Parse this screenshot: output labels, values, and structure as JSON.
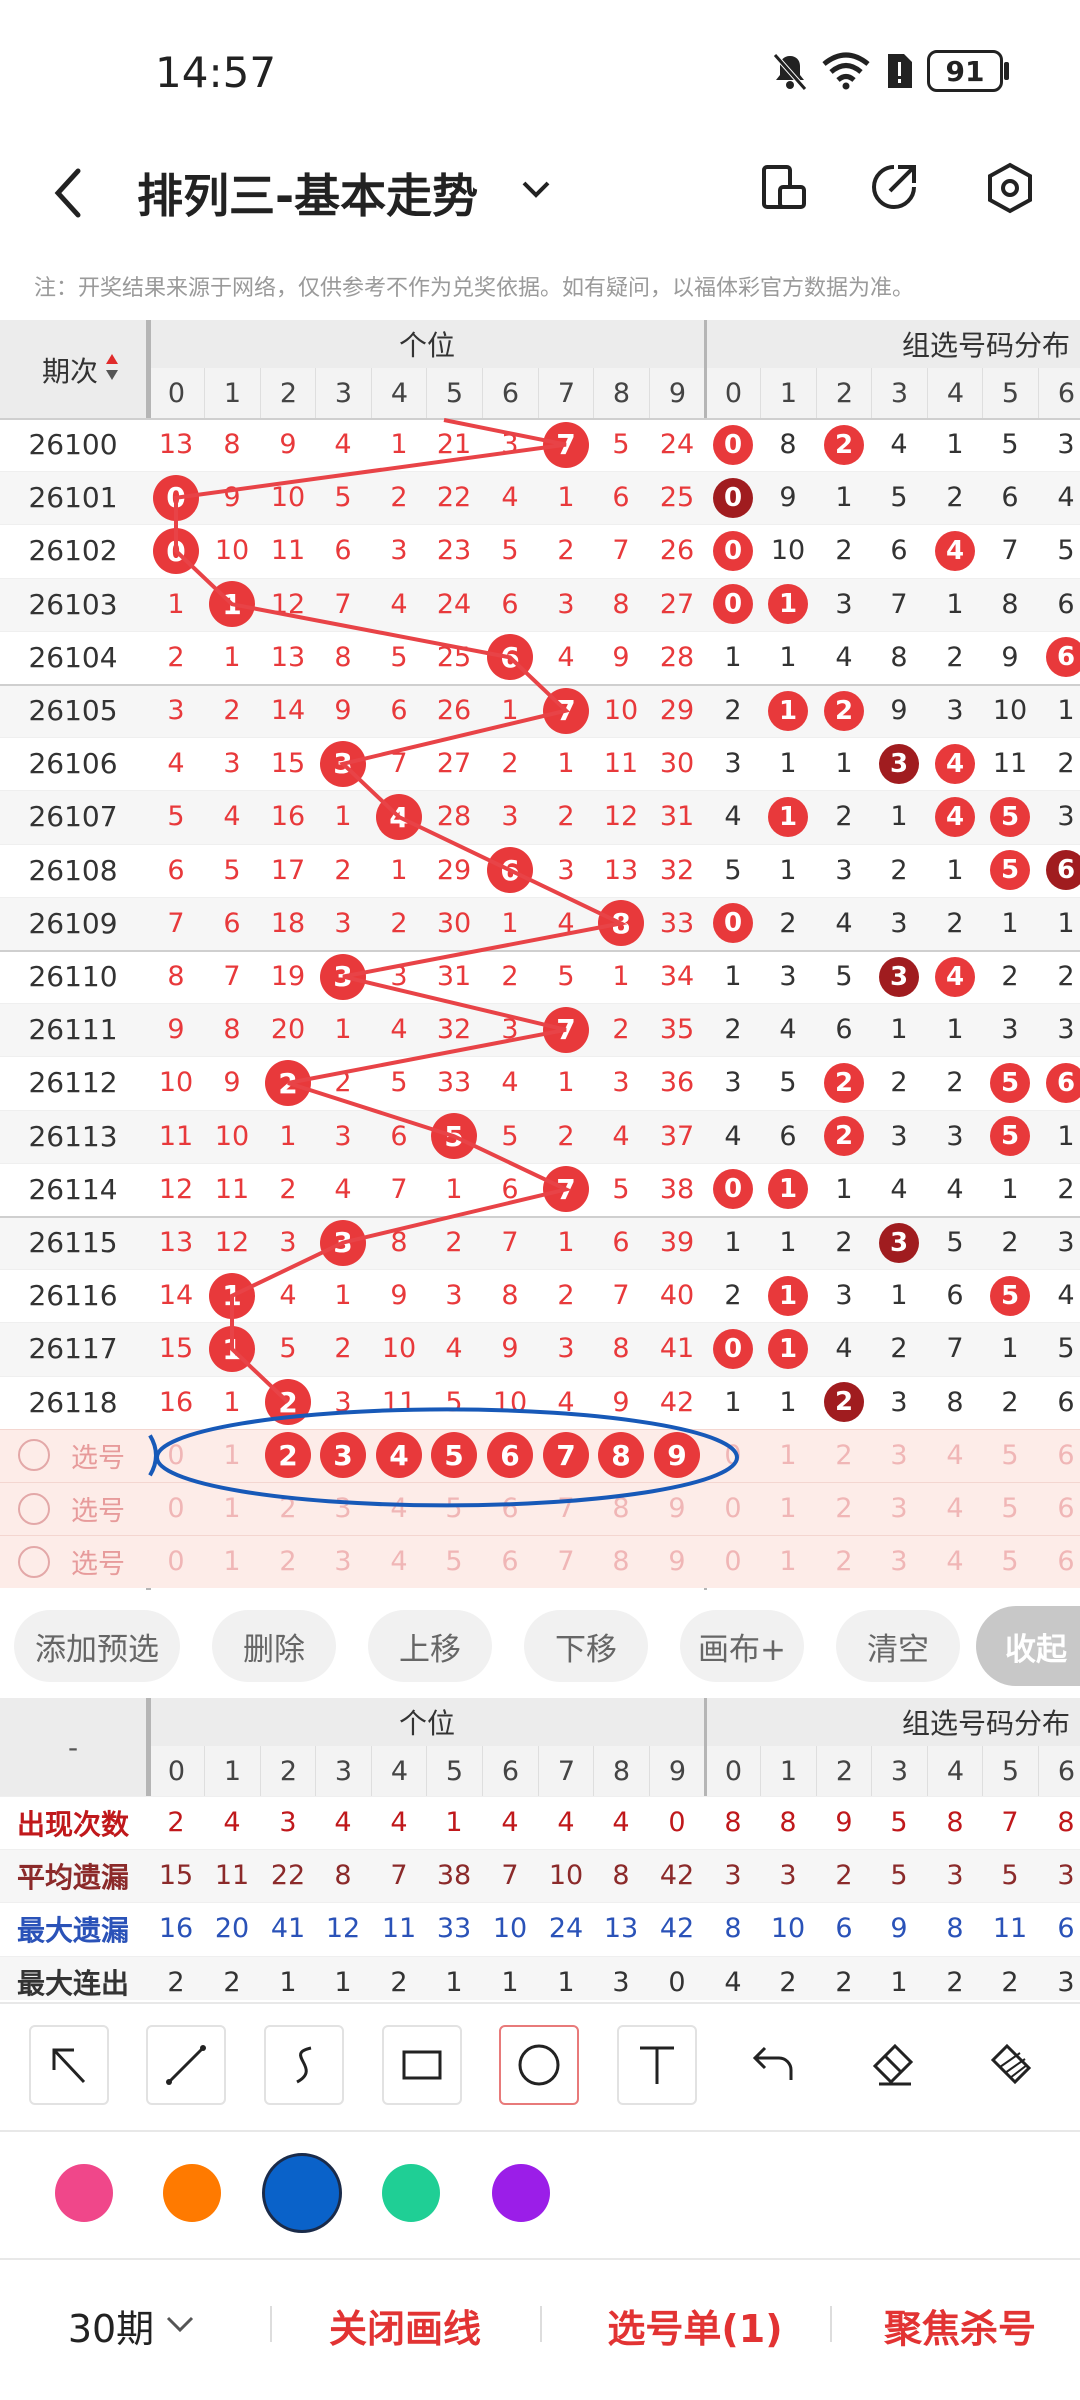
{
  "status_bar": {
    "time": "14:57",
    "battery": "91",
    "icons": [
      "mute-icon",
      "wifi-icon",
      "sim-alert-icon",
      "battery-icon"
    ]
  },
  "header": {
    "title": "排列三-基本走势",
    "icons": [
      "back-icon",
      "dropdown-chevron-icon",
      "layout-icon",
      "share-icon",
      "settings-icon"
    ]
  },
  "note": "注：开奖结果来源于网络，仅供参考不作为兑奖依据。如有疑问，以福体彩官方数据为准。",
  "main_table": {
    "period_header": "期次",
    "section_left": "个位",
    "section_right": "组选号码分布",
    "columns_left": [
      "0",
      "1",
      "2",
      "3",
      "4",
      "5",
      "6",
      "7",
      "8",
      "9"
    ],
    "columns_right": [
      "0",
      "1",
      "2",
      "3",
      "4",
      "5",
      "6"
    ],
    "rows": [
      {
        "period": "26100",
        "left": [
          "13",
          "8",
          "9",
          "4",
          "1",
          "21",
          "3",
          "7",
          "5",
          "24"
        ],
        "hit": 7,
        "right": [
          "0",
          "8",
          "2",
          "4",
          "1",
          "5",
          "3"
        ],
        "right_hits": [
          0,
          2
        ],
        "dark": []
      },
      {
        "period": "26101",
        "left": [
          "0",
          "9",
          "10",
          "5",
          "2",
          "22",
          "4",
          "1",
          "6",
          "25"
        ],
        "hit": 0,
        "right": [
          "0",
          "9",
          "1",
          "5",
          "2",
          "6",
          "4"
        ],
        "right_hits": [
          0
        ],
        "dark": [
          0
        ]
      },
      {
        "period": "26102",
        "left": [
          "0",
          "10",
          "11",
          "6",
          "3",
          "23",
          "5",
          "2",
          "7",
          "26"
        ],
        "hit": 0,
        "right": [
          "0",
          "10",
          "2",
          "6",
          "4",
          "7",
          "5"
        ],
        "right_hits": [
          0,
          4
        ],
        "dark": []
      },
      {
        "period": "26103",
        "left": [
          "1",
          "1",
          "12",
          "7",
          "4",
          "24",
          "6",
          "3",
          "8",
          "27"
        ],
        "hit": 1,
        "right": [
          "0",
          "1",
          "3",
          "7",
          "1",
          "8",
          "6"
        ],
        "right_hits": [
          0,
          1
        ],
        "dark": []
      },
      {
        "period": "26104",
        "left": [
          "2",
          "1",
          "13",
          "8",
          "5",
          "25",
          "6",
          "4",
          "9",
          "28"
        ],
        "hit": 6,
        "right": [
          "1",
          "1",
          "4",
          "8",
          "2",
          "9",
          "6"
        ],
        "right_hits": [
          6
        ],
        "dark": []
      },
      {
        "period": "26105",
        "left": [
          "3",
          "2",
          "14",
          "9",
          "6",
          "26",
          "1",
          "7",
          "10",
          "29"
        ],
        "hit": 7,
        "right": [
          "2",
          "1",
          "2",
          "9",
          "3",
          "10",
          "1"
        ],
        "right_hits": [
          1,
          2
        ],
        "dark": []
      },
      {
        "period": "26106",
        "left": [
          "4",
          "3",
          "15",
          "3",
          "7",
          "27",
          "2",
          "1",
          "11",
          "30"
        ],
        "hit": 3,
        "right": [
          "3",
          "1",
          "1",
          "3",
          "4",
          "11",
          "2"
        ],
        "right_hits": [
          3,
          4
        ],
        "dark": [
          3
        ]
      },
      {
        "period": "26107",
        "left": [
          "5",
          "4",
          "16",
          "1",
          "4",
          "28",
          "3",
          "2",
          "12",
          "31"
        ],
        "hit": 4,
        "right": [
          "4",
          "1",
          "2",
          "1",
          "4",
          "5",
          "3"
        ],
        "right_hits": [
          1,
          4,
          5
        ],
        "dark": []
      },
      {
        "period": "26108",
        "left": [
          "6",
          "5",
          "17",
          "2",
          "1",
          "29",
          "6",
          "3",
          "13",
          "32"
        ],
        "hit": 6,
        "right": [
          "5",
          "1",
          "3",
          "2",
          "1",
          "5",
          "6"
        ],
        "right_hits": [
          5,
          6
        ],
        "dark": [
          6
        ]
      },
      {
        "period": "26109",
        "left": [
          "7",
          "6",
          "18",
          "3",
          "2",
          "30",
          "1",
          "4",
          "8",
          "33"
        ],
        "hit": 8,
        "right": [
          "0",
          "2",
          "4",
          "3",
          "2",
          "1",
          "1"
        ],
        "right_hits": [
          0
        ],
        "dark": []
      },
      {
        "period": "26110",
        "left": [
          "8",
          "7",
          "19",
          "3",
          "3",
          "31",
          "2",
          "5",
          "1",
          "34"
        ],
        "hit": 3,
        "right": [
          "1",
          "3",
          "5",
          "3",
          "4",
          "2",
          "2"
        ],
        "right_hits": [
          3,
          4
        ],
        "dark": [
          3
        ]
      },
      {
        "period": "26111",
        "left": [
          "9",
          "8",
          "20",
          "1",
          "4",
          "32",
          "3",
          "7",
          "2",
          "35"
        ],
        "hit": 7,
        "right": [
          "2",
          "4",
          "6",
          "1",
          "1",
          "3",
          "3"
        ],
        "right_hits": [],
        "dark": []
      },
      {
        "period": "26112",
        "left": [
          "10",
          "9",
          "2",
          "2",
          "5",
          "33",
          "4",
          "1",
          "3",
          "36"
        ],
        "hit": 2,
        "right": [
          "3",
          "5",
          "2",
          "2",
          "2",
          "5",
          "6"
        ],
        "right_hits": [
          2,
          5,
          6
        ],
        "dark": []
      },
      {
        "period": "26113",
        "left": [
          "11",
          "10",
          "1",
          "3",
          "6",
          "5",
          "5",
          "2",
          "4",
          "37"
        ],
        "hit": 5,
        "right": [
          "4",
          "6",
          "2",
          "3",
          "3",
          "5",
          "1"
        ],
        "right_hits": [
          2,
          5
        ],
        "dark": []
      },
      {
        "period": "26114",
        "left": [
          "12",
          "11",
          "2",
          "4",
          "7",
          "1",
          "6",
          "7",
          "5",
          "38"
        ],
        "hit": 7,
        "right": [
          "0",
          "1",
          "1",
          "4",
          "4",
          "1",
          "2"
        ],
        "right_hits": [
          0,
          1
        ],
        "dark": []
      },
      {
        "period": "26115",
        "left": [
          "13",
          "12",
          "3",
          "3",
          "8",
          "2",
          "7",
          "1",
          "6",
          "39"
        ],
        "hit": 3,
        "right": [
          "1",
          "1",
          "2",
          "3",
          "5",
          "2",
          "3"
        ],
        "right_hits": [
          3
        ],
        "dark": [
          3
        ]
      },
      {
        "period": "26116",
        "left": [
          "14",
          "1",
          "4",
          "1",
          "9",
          "3",
          "8",
          "2",
          "7",
          "40"
        ],
        "hit": 1,
        "right": [
          "2",
          "1",
          "3",
          "1",
          "6",
          "5",
          "4"
        ],
        "right_hits": [
          1,
          5
        ],
        "dark": []
      },
      {
        "period": "26117",
        "left": [
          "15",
          "1",
          "5",
          "2",
          "10",
          "4",
          "9",
          "3",
          "8",
          "41"
        ],
        "hit": 1,
        "right": [
          "0",
          "1",
          "4",
          "2",
          "7",
          "1",
          "5"
        ],
        "right_hits": [
          0,
          1
        ],
        "dark": []
      },
      {
        "period": "26118",
        "left": [
          "16",
          "1",
          "2",
          "3",
          "11",
          "5",
          "10",
          "4",
          "9",
          "42"
        ],
        "hit": 2,
        "right": [
          "1",
          "1",
          "2",
          "3",
          "8",
          "2",
          "6"
        ],
        "right_hits": [
          2
        ],
        "dark": [
          2
        ]
      }
    ],
    "select_label": "选号",
    "select_rows": [
      {
        "left": [
          "0",
          "1",
          "2",
          "3",
          "4",
          "5",
          "6",
          "7",
          "8",
          "9"
        ],
        "right": [
          "0",
          "1",
          "2",
          "3",
          "4",
          "5",
          "6"
        ],
        "selected": [
          2,
          3,
          4,
          5,
          6,
          7,
          8,
          9
        ]
      },
      {
        "left": [
          "0",
          "1",
          "2",
          "3",
          "4",
          "5",
          "6",
          "7",
          "8",
          "9"
        ],
        "right": [
          "0",
          "1",
          "2",
          "3",
          "4",
          "5",
          "6"
        ],
        "selected": []
      },
      {
        "left": [
          "0",
          "1",
          "2",
          "3",
          "4",
          "5",
          "6",
          "7",
          "8",
          "9"
        ],
        "right": [
          "0",
          "1",
          "2",
          "3",
          "4",
          "5",
          "6"
        ],
        "selected": []
      }
    ]
  },
  "action_buttons": [
    "添加预选",
    "删除",
    "上移",
    "下移",
    "画布+",
    "清空",
    "收起"
  ],
  "stats_table": {
    "corner": "-",
    "section_left": "个位",
    "section_right": "组选号码分布",
    "columns_left": [
      "0",
      "1",
      "2",
      "3",
      "4",
      "5",
      "6",
      "7",
      "8",
      "9"
    ],
    "columns_right": [
      "0",
      "1",
      "2",
      "3",
      "4",
      "5",
      "6"
    ],
    "rows": [
      {
        "label": "出现次数",
        "color": "#c0181b",
        "left": [
          "2",
          "4",
          "3",
          "4",
          "4",
          "1",
          "4",
          "4",
          "4",
          "0"
        ],
        "right": [
          "8",
          "8",
          "9",
          "5",
          "8",
          "7",
          "8"
        ]
      },
      {
        "label": "平均遗漏",
        "color": "#8b2a2a",
        "left": [
          "15",
          "11",
          "22",
          "8",
          "7",
          "38",
          "7",
          "10",
          "8",
          "42"
        ],
        "right": [
          "3",
          "3",
          "2",
          "5",
          "3",
          "5",
          "3"
        ]
      },
      {
        "label": "最大遗漏",
        "color": "#2a52b8",
        "left": [
          "16",
          "20",
          "41",
          "12",
          "11",
          "33",
          "10",
          "24",
          "13",
          "42"
        ],
        "right": [
          "8",
          "10",
          "6",
          "9",
          "8",
          "11",
          "6"
        ]
      },
      {
        "label": "最大连出",
        "color": "#333333",
        "left": [
          "2",
          "2",
          "1",
          "1",
          "2",
          "1",
          "1",
          "1",
          "3",
          "0"
        ],
        "right": [
          "4",
          "2",
          "2",
          "1",
          "2",
          "2",
          "3"
        ]
      }
    ]
  },
  "draw_tools": [
    "arrow-tool-icon",
    "line-tool-icon",
    "curve-tool-icon",
    "rectangle-tool-icon",
    "circle-tool-icon",
    "text-tool-icon",
    "undo-icon",
    "eraser-icon",
    "clear-brush-icon"
  ],
  "palette": {
    "colors": [
      "#f0478a",
      "#ff7a00",
      "#0a62c9",
      "#1fcf95",
      "#9b1ee8"
    ],
    "selected_index": 2
  },
  "bottom_bar": {
    "period_select": "30期",
    "close_lines": "关闭画线",
    "pick_list": "选号单(1)",
    "focus_kill": "聚焦杀号"
  },
  "colors": {
    "red": "#e8393b",
    "dark_red": "#a01c1f",
    "line": "#e84347",
    "ellipse": "#1759b8"
  }
}
